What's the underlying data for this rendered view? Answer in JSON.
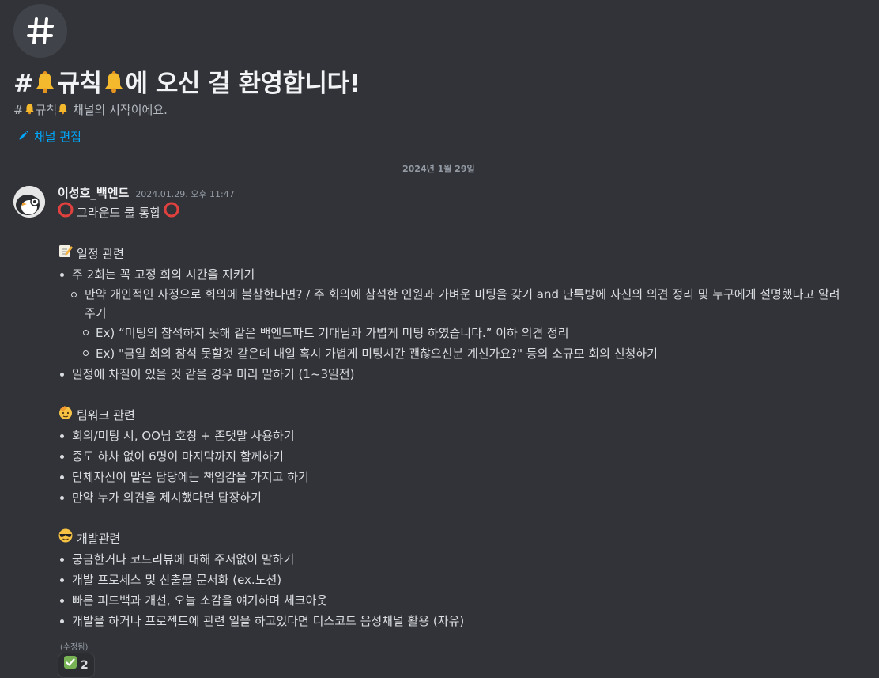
{
  "channel_header": {
    "title_prefix": "#",
    "title_channel": "규칙",
    "title_suffix": "에 오신 걸 환영합니다!",
    "subtitle_prefix": "#",
    "subtitle_channel": "규칙",
    "subtitle_suffix": " 채널의 시작이에요.",
    "edit_label": "채널 편집"
  },
  "date_divider": "2024년 1월 29일",
  "message": {
    "author": "이성호_백엔드",
    "timestamp": "2024.01.29. 오후 11:47",
    "title": "그라운드 룰 통합",
    "section1": {
      "heading": "일정 관련",
      "item1": "주 2회는 꼭 고정 회의 시간을 지키기",
      "item1_sub1": "만약 개인적인 사정으로 회의에 불참한다면? / 주 회의에 참석한 인원과 가벼운 미팅을 갖기 and 단톡방에 자신의 의견 정리 및 누구에게 설명했다고 알려주기",
      "item1_sub1_ex1": "Ex) “미팅의 참석하지 못해 같은 백엔드파트 기대님과 가볍게 미팅 하였습니다.” 이하 의견 정리",
      "item1_sub1_ex2": "Ex) \"금일 회의 참석 못할것 같은데 내일 혹시 가볍게 미팅시간 괜찮으신분 계신가요?\" 등의 소규모 회의 신청하기",
      "item2": "일정에 차질이 있을 것 같을 경우 미리 말하기 (1~3일전)"
    },
    "section2": {
      "heading": "팀워크 관련",
      "items": [
        "회의/미팅 시, OO님 호칭 + 존댓말 사용하기",
        "중도 하차 없이 6명이 마지막까지 함께하기",
        "단체자신이 맡은 담당에는 책임감을 가지고 하기",
        "만약 누가 의견을 제시했다면 답장하기"
      ]
    },
    "section3": {
      "heading": "개발관련",
      "items": [
        "궁금한거나 코드리뷰에 대해 주저없이 말하기",
        "개발 프로세스 및 산출물 문서화 (ex.노션)",
        "빠른 피드백과 개선, 오늘 소감을 얘기하며 체크아웃",
        "개발을 하거나 프로젝트에 관련 일을 하고있다면 디스코드 음성채널 활용 (자유)"
      ]
    },
    "edited_label": "(수정됨)",
    "reaction": {
      "emoji": "check-mark-icon",
      "count": "2"
    }
  },
  "colors": {
    "background": "#313338",
    "link": "#00a8fc",
    "text": "#dbdee1"
  }
}
